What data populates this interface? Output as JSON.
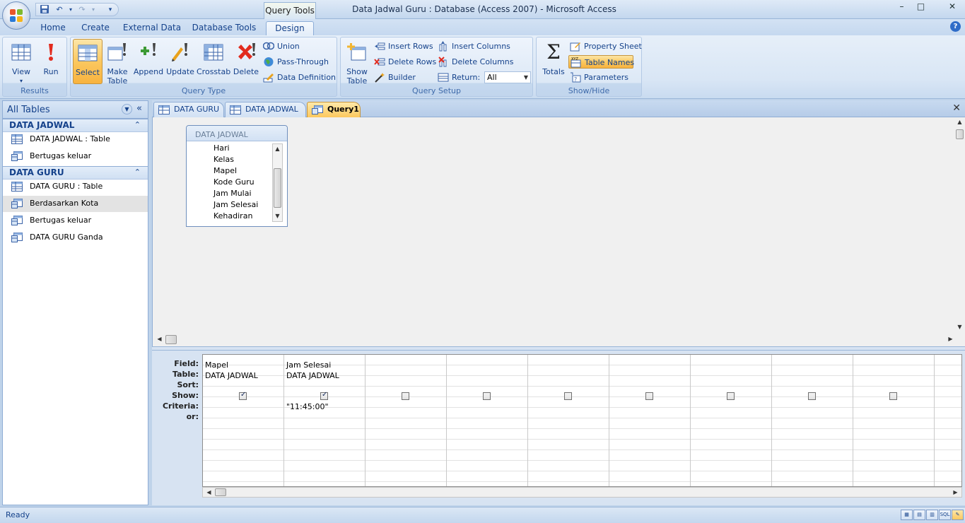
{
  "window": {
    "title": "Data Jadwal Guru : Database (Access 2007) - Microsoft Access",
    "context_tab": "Query Tools",
    "controls": {
      "minimize": "–",
      "maximize": "□",
      "close": "✕"
    }
  },
  "ribbon_tabs": [
    "Home",
    "Create",
    "External Data",
    "Database Tools",
    "Design"
  ],
  "ribbon": {
    "results": {
      "label": "Results",
      "view": "View",
      "run": "Run"
    },
    "query_type": {
      "label": "Query Type",
      "select": "Select",
      "make_table": "Make\nTable",
      "append": "Append",
      "update": "Update",
      "crosstab": "Crosstab",
      "delete": "Delete",
      "union": "Union",
      "pass_through": "Pass-Through",
      "data_definition": "Data Definition"
    },
    "query_setup": {
      "label": "Query Setup",
      "show_table": "Show\nTable",
      "insert_rows": "Insert Rows",
      "delete_rows": "Delete Rows",
      "builder": "Builder",
      "insert_columns": "Insert Columns",
      "delete_columns": "Delete Columns",
      "return_label": "Return:",
      "return_value": "All"
    },
    "show_hide": {
      "label": "Show/Hide",
      "totals": "Totals",
      "property_sheet": "Property Sheet",
      "table_names": "Table Names",
      "parameters": "Parameters"
    }
  },
  "nav": {
    "title": "All Tables",
    "groups": [
      {
        "name": "DATA JADWAL",
        "items": [
          "DATA JADWAL : Table",
          "Bertugas keluar"
        ]
      },
      {
        "name": "DATA GURU",
        "items": [
          "DATA GURU : Table",
          "Berdasarkan Kota",
          "Bertugas keluar",
          "DATA GURU Ganda"
        ]
      }
    ]
  },
  "doc_tabs": [
    "DATA GURU",
    "DATA JADWAL",
    "Query1"
  ],
  "table_box": {
    "title": "DATA JADWAL",
    "fields": [
      "Hari",
      "Kelas",
      "Mapel",
      "Kode Guru",
      "Jam Mulai",
      "Jam Selesai",
      "Kehadiran"
    ]
  },
  "qbe": {
    "row_labels": [
      "Field:",
      "Table:",
      "Sort:",
      "Show:",
      "Criteria:",
      "or:"
    ],
    "columns": [
      {
        "field": "Mapel",
        "table": "DATA JADWAL",
        "show": true,
        "criteria": ""
      },
      {
        "field": "Jam Selesai",
        "table": "DATA JADWAL",
        "show": true,
        "criteria": "\"11:45:00\""
      },
      {
        "field": "",
        "table": "",
        "show": false,
        "criteria": ""
      },
      {
        "field": "",
        "table": "",
        "show": false,
        "criteria": ""
      },
      {
        "field": "",
        "table": "",
        "show": false,
        "criteria": ""
      },
      {
        "field": "",
        "table": "",
        "show": false,
        "criteria": ""
      },
      {
        "field": "",
        "table": "",
        "show": false,
        "criteria": ""
      },
      {
        "field": "",
        "table": "",
        "show": false,
        "criteria": ""
      },
      {
        "field": "",
        "table": "",
        "show": false,
        "criteria": ""
      }
    ]
  },
  "status": {
    "text": "Ready",
    "views": [
      "▦",
      "▤",
      "▥",
      "SQL",
      "✎"
    ]
  },
  "colors": {
    "accent": "#15428b",
    "active_tab": "#fcc85e",
    "ribbon": "#dce8f6"
  }
}
